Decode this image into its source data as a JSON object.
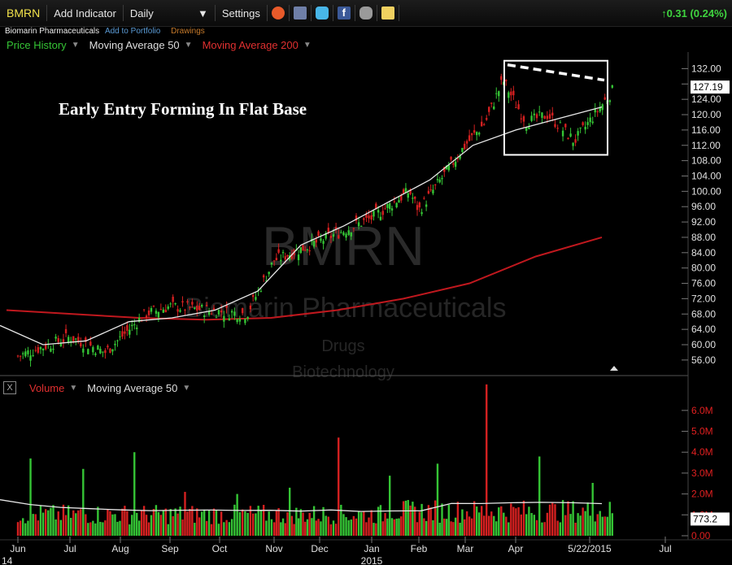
{
  "toolbar": {
    "symbol": "BMRN",
    "add_indicator": "Add Indicator",
    "interval": "Daily",
    "settings": "Settings",
    "change": "0.31 (0.24%)",
    "icons": [
      "alarm-clock-icon",
      "book-icon",
      "twitter-icon",
      "facebook-icon",
      "binoculars-icon",
      "note-icon"
    ]
  },
  "subheader": {
    "company": "Biomarin Pharmaceuticals",
    "add_portfolio": "Add to Portfolio",
    "drawings": "Drawings"
  },
  "legend": {
    "price_history": "Price History",
    "ma50": "Moving Average 50",
    "ma200": "Moving Average 200"
  },
  "volume_legend": {
    "volume": "Volume",
    "ma50": "Moving Average 50"
  },
  "colors": {
    "up": "#35c435",
    "down": "#d42020",
    "ma50": "#e8e8e8",
    "ma200": "#c0181e",
    "axis_text": "#e0e0e0",
    "vol_axis_text": "#e02020",
    "accent_green": "#3fd43f"
  },
  "chart_data": {
    "type": "line",
    "symbol": "BMRN",
    "annotation": "Early Entry Forming In Flat Base",
    "watermark": {
      "symbol": "BMRN",
      "name": "Biomarin Pharmaceuticals",
      "sector": "Drugs",
      "industry": "Biotechnology"
    },
    "price_axis": {
      "ticks": [
        "132.00",
        "128.00",
        "124.00",
        "120.00",
        "116.00",
        "112.00",
        "108.00",
        "104.00",
        "100.00",
        "96.00",
        "92.00",
        "88.00",
        "84.00",
        "80.00",
        "76.00",
        "72.00",
        "68.00",
        "64.00",
        "60.00",
        "56.00"
      ],
      "last": "127.19",
      "ylim": [
        53,
        134
      ]
    },
    "volume_axis": {
      "ticks": [
        "6.0M",
        "5.0M",
        "4.0M",
        "3.0M",
        "2.0M",
        "1.0M",
        "0.00"
      ],
      "last": "773.2",
      "ylim": [
        0,
        6.5
      ]
    },
    "x_labels": [
      "Jun",
      "Jul",
      "Aug",
      "Sep",
      "Oct",
      "Nov",
      "Dec",
      "Jan",
      "Feb",
      "Mar",
      "Apr",
      "5/22/2015",
      "Jul"
    ],
    "x_sublabels": [
      "14",
      "2015"
    ],
    "price_series": {
      "name": "Price History",
      "months": [
        "Jun",
        "Jul",
        "Aug",
        "Sep",
        "Oct",
        "Nov",
        "Dec",
        "Jan",
        "Feb",
        "Mar",
        "Apr",
        "May"
      ],
      "close_anchors": [
        57,
        62,
        58,
        68,
        70,
        68,
        82,
        87,
        93,
        100,
        95,
        112,
        118,
        129,
        118,
        120,
        113,
        127
      ],
      "anchor_month_index": [
        0,
        1,
        1.7,
        2.5,
        3.0,
        4.5,
        5.0,
        6.0,
        7.0,
        7.8,
        8.0,
        9.0,
        9.4,
        9.75,
        10.2,
        10.6,
        11.1,
        11.9
      ]
    },
    "ma50_anchors": [
      65,
      60,
      61,
      66,
      67,
      69,
      74,
      86,
      91,
      97,
      103,
      112,
      116,
      119,
      122
    ],
    "ma200_anchors": [
      69,
      68,
      67,
      66.5,
      67,
      69,
      72,
      76,
      83,
      88
    ],
    "trendline": {
      "from": 133,
      "to": 129
    },
    "base_box": {
      "top": 133,
      "bottom": 111
    },
    "volume": {
      "typical_m": 1.2,
      "spikes_m": [
        3.7,
        3.2,
        4.0,
        2.1,
        2.0,
        2.3,
        4.7,
        2.5,
        3.0,
        6.3,
        3.3,
        2.2
      ]
    }
  }
}
